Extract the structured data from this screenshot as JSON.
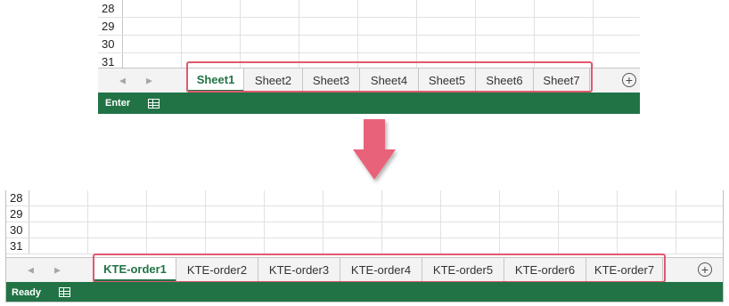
{
  "top": {
    "rows": [
      "28",
      "29",
      "30",
      "31"
    ],
    "tabs": [
      "Sheet1",
      "Sheet2",
      "Sheet3",
      "Sheet4",
      "Sheet5",
      "Sheet6",
      "Sheet7"
    ],
    "active_tab": "Sheet1",
    "add_sheet_glyph": "+",
    "status": "Enter"
  },
  "bottom": {
    "rows": [
      "28",
      "29",
      "30",
      "31"
    ],
    "tabs": [
      "KTE-order1",
      "KTE-order2",
      "KTE-order3",
      "KTE-order4",
      "KTE-order5",
      "KTE-order6",
      "KTE-order7"
    ],
    "active_tab": "KTE-order1",
    "add_sheet_glyph": "+",
    "status": "Ready"
  },
  "colors": {
    "excel_green": "#217346",
    "highlight": "#e0596f",
    "arrow": "#e86479"
  },
  "icons": {
    "nav_prev": "◀",
    "nav_next": "▶",
    "page_view": "page-layout-icon",
    "down_arrow": "down-arrow-icon"
  }
}
